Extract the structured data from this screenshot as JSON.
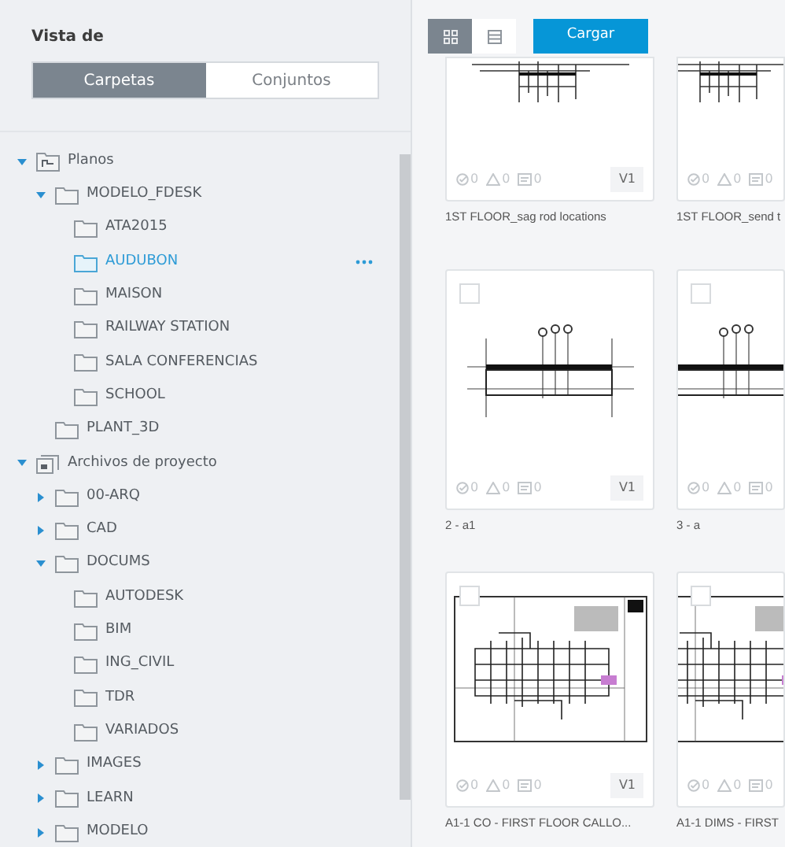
{
  "sidebar": {
    "title": "Vista de",
    "view_tabs": [
      {
        "label": "Carpetas",
        "selected": true
      },
      {
        "label": "Conjuntos",
        "selected": false
      }
    ],
    "tree": [
      {
        "label": "Planos",
        "kind": "plans",
        "expanded": true,
        "children": [
          {
            "label": "MODELO_FDESK",
            "kind": "folder",
            "expanded": true,
            "children": [
              {
                "label": "ATA2015",
                "kind": "folder",
                "selected": false
              },
              {
                "label": "AUDUBON",
                "kind": "folder",
                "selected": true
              },
              {
                "label": "MAISON",
                "kind": "folder",
                "selected": false
              },
              {
                "label": "RAILWAY STATION",
                "kind": "folder",
                "selected": false
              },
              {
                "label": "SALA CONFERENCIAS",
                "kind": "folder",
                "selected": false
              },
              {
                "label": "SCHOOL",
                "kind": "folder",
                "selected": false
              }
            ]
          },
          {
            "label": "PLANT_3D",
            "kind": "folder",
            "selected": false
          }
        ]
      },
      {
        "label": "Archivos de proyecto",
        "kind": "project",
        "expanded": true,
        "children": [
          {
            "label": "00-ARQ",
            "kind": "folder",
            "expanded": false
          },
          {
            "label": "CAD",
            "kind": "folder",
            "expanded": false
          },
          {
            "label": "DOCUMS",
            "kind": "folder",
            "expanded": true,
            "children": [
              {
                "label": "AUTODESK",
                "kind": "folder",
                "selected": false
              },
              {
                "label": "BIM",
                "kind": "folder",
                "selected": false
              },
              {
                "label": "ING_CIVIL",
                "kind": "folder",
                "selected": false
              },
              {
                "label": "TDR",
                "kind": "folder",
                "selected": false
              },
              {
                "label": "VARIADOS",
                "kind": "folder",
                "selected": false
              }
            ]
          },
          {
            "label": "IMAGES",
            "kind": "folder",
            "expanded": false
          },
          {
            "label": "LEARN",
            "kind": "folder",
            "expanded": false
          },
          {
            "label": "MODELO",
            "kind": "folder",
            "expanded": false
          }
        ]
      }
    ]
  },
  "toolbar": {
    "view_modes": [
      {
        "kind": "grid",
        "selected": true
      },
      {
        "kind": "list",
        "selected": false
      }
    ],
    "upload_button": "Cargar"
  },
  "cards": [
    {
      "name": "1ST FLOOR_sag rod locations",
      "kind": "plan-top",
      "counts": [
        "0",
        "0",
        "0"
      ],
      "version": "V1"
    },
    {
      "name": "1ST FLOOR_send t",
      "kind": "plan-top",
      "counts": [
        "0",
        "0",
        "0"
      ]
    },
    {
      "name": "2 - a1",
      "kind": "elevation",
      "checked": false,
      "counts": [
        "0",
        "0",
        "0"
      ],
      "version": "V1"
    },
    {
      "name": "3 - a",
      "kind": "elevation",
      "checked": false,
      "counts": [
        "0",
        "0",
        "0"
      ]
    },
    {
      "name": "A1-1 CO - FIRST FLOOR CALLO...",
      "kind": "floorplan",
      "checked": false,
      "counts": [
        "0",
        "0",
        "0"
      ],
      "version": "V1"
    },
    {
      "name": "A1-1 DIMS - FIRST",
      "kind": "floorplan",
      "checked": false,
      "counts": [
        "0",
        "0",
        "0"
      ]
    }
  ]
}
